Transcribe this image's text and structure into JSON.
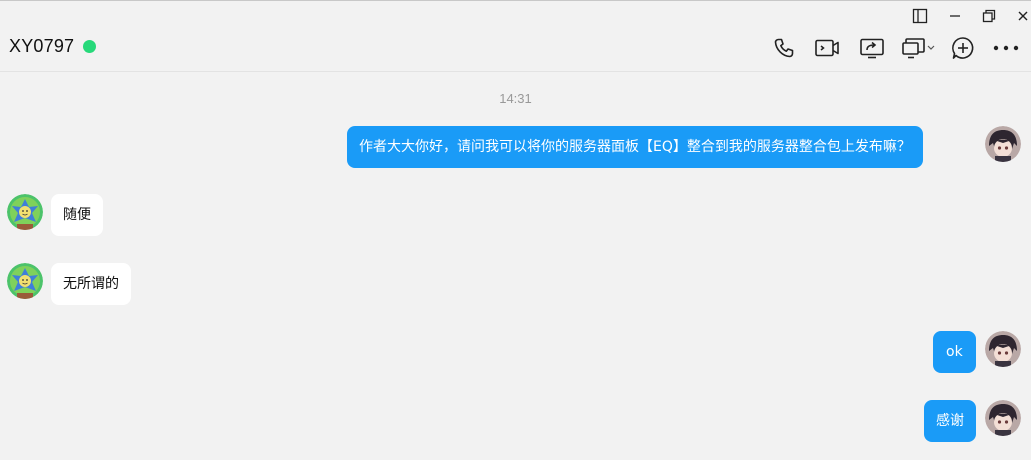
{
  "window": {
    "controls": [
      "sidebar-toggle-icon",
      "minimize-icon",
      "restore-icon",
      "close-icon"
    ]
  },
  "header": {
    "contact_name": "XY0797",
    "status_color": "#27d97a",
    "toolbar": [
      "phone-icon",
      "video-call-icon",
      "screen-share-icon",
      "remote-desktop-icon",
      "add-icon",
      "more-icon"
    ]
  },
  "chat": {
    "timestamp": "14:31",
    "messages": [
      {
        "side": "out",
        "text": "作者大大你好，请问我可以将你的服务器面板【EQ】整合到我的服务器整合包上发布嘛？"
      },
      {
        "side": "in",
        "text": "随便"
      },
      {
        "side": "in",
        "text": "无所谓的"
      },
      {
        "side": "out",
        "text": "ok"
      },
      {
        "side": "out",
        "text": "感谢"
      }
    ]
  },
  "colors": {
    "outgoing_bubble": "#1a9bf7",
    "incoming_bubble": "#ffffff",
    "background": "#f2f2f2"
  }
}
